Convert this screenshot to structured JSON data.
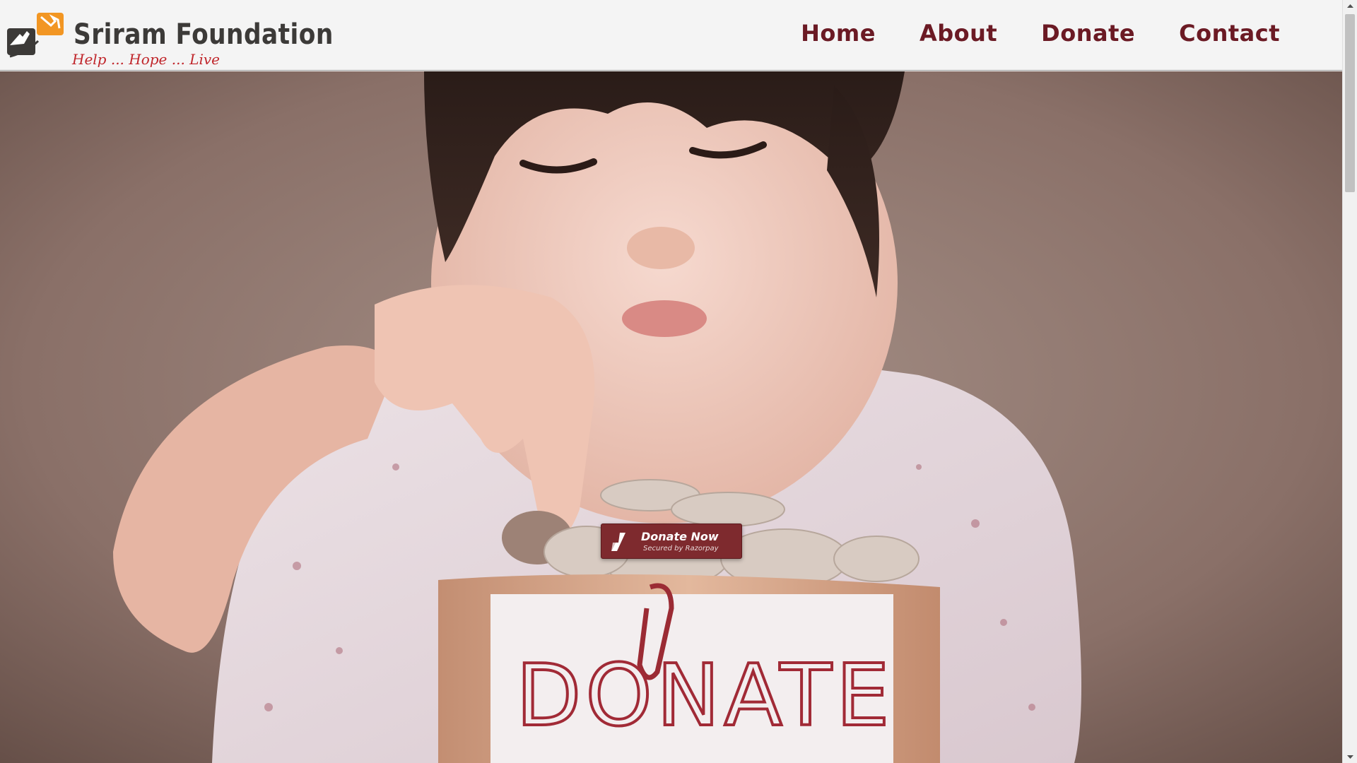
{
  "brand": {
    "name": "Sriram Foundation",
    "tagline": "Help ... Hope ... Live",
    "colors": {
      "title": "#3c3a38",
      "tagline": "#c0262b",
      "accent": "#f29623"
    }
  },
  "nav": {
    "items": [
      {
        "label": "Home"
      },
      {
        "label": "About"
      },
      {
        "label": "Donate"
      },
      {
        "label": "Contact"
      }
    ],
    "color": "#6b1a24"
  },
  "hero": {
    "image": "child-dropping-coin-into-donation-box",
    "box_label": "DONATE"
  },
  "donate_button": {
    "label": "Donate Now",
    "sublabel": "Secured by Razorpay",
    "icon": "razorpay-icon",
    "color": "#7e2a2e"
  }
}
